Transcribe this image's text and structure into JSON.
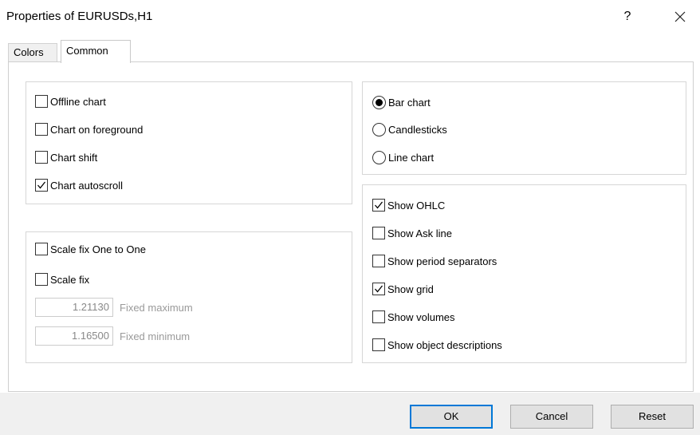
{
  "window": {
    "title": "Properties of EURUSDs,H1",
    "help_label": "?"
  },
  "tabs": [
    {
      "label": "Colors",
      "active": false
    },
    {
      "label": "Common",
      "active": true
    }
  ],
  "chart_options": [
    {
      "label": "Offline chart",
      "checked": false
    },
    {
      "label": "Chart on foreground",
      "checked": false
    },
    {
      "label": "Chart shift",
      "checked": false
    },
    {
      "label": "Chart autoscroll",
      "checked": true
    }
  ],
  "scale_options": {
    "checkboxes": [
      {
        "label": "Scale fix One to One",
        "checked": false
      },
      {
        "label": "Scale fix",
        "checked": false
      }
    ],
    "fixed_maximum": {
      "value": "1.21130",
      "label": "Fixed maximum"
    },
    "fixed_minimum": {
      "value": "1.16500",
      "label": "Fixed minimum"
    }
  },
  "chart_type": {
    "options": [
      "Bar chart",
      "Candlesticks",
      "Line chart"
    ],
    "selected": "Bar chart"
  },
  "show_options": [
    {
      "label": "Show OHLC",
      "checked": true
    },
    {
      "label": "Show Ask line",
      "checked": false
    },
    {
      "label": "Show period separators",
      "checked": false
    },
    {
      "label": "Show grid",
      "checked": true
    },
    {
      "label": "Show volumes",
      "checked": false
    },
    {
      "label": "Show object descriptions",
      "checked": false
    }
  ],
  "buttons": {
    "ok": "OK",
    "cancel": "Cancel",
    "reset": "Reset"
  }
}
